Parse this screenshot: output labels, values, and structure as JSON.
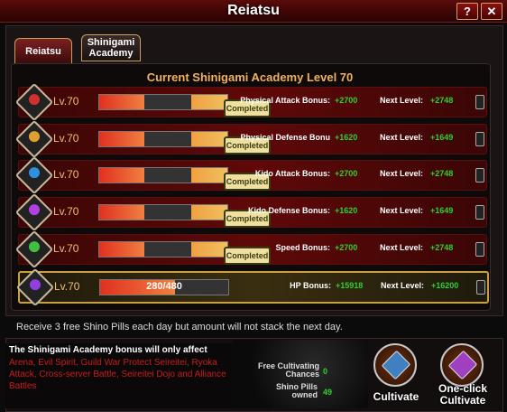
{
  "window": {
    "title": "Reiatsu",
    "help_label": "?",
    "close_label": "✕"
  },
  "tabs": [
    {
      "label": "Reiatsu"
    },
    {
      "label": "Shinigami Academy"
    }
  ],
  "heading": "Current Shinigami Academy Level 70",
  "rows": [
    {
      "level": "Lv.70",
      "status": "Completed",
      "bonus_label": "Physical Attack Bonus:",
      "bonus_value": "+2700",
      "next_label": "Next Level:",
      "next_value": "+2748",
      "icon": "fist-icon",
      "color": "#d03030"
    },
    {
      "level": "Lv.70",
      "status": "Completed",
      "bonus_label": "Physical Defense Bonu",
      "bonus_value": "+1620",
      "next_label": "Next Level:",
      "next_value": "+1649",
      "icon": "shield-icon",
      "color": "#e0a030"
    },
    {
      "level": "Lv.70",
      "status": "Completed",
      "bonus_label": "Kido Attack Bonus:",
      "bonus_value": "+2700",
      "next_label": "Next Level:",
      "next_value": "+2748",
      "icon": "spiral-icon",
      "color": "#3090e0"
    },
    {
      "level": "Lv.70",
      "status": "Completed",
      "bonus_label": "Kido Defense Bonus:",
      "bonus_value": "+1620",
      "next_label": "Next Level:",
      "next_value": "+1649",
      "icon": "half-moon-icon",
      "color": "#b040e0"
    },
    {
      "level": "Lv.70",
      "status": "Completed",
      "bonus_label": "Speed Bonus:",
      "bonus_value": "+2700",
      "next_label": "Next Level:",
      "next_value": "+2748",
      "icon": "wing-icon",
      "color": "#40c040"
    },
    {
      "level": "Lv.70",
      "progress_text": "280/480",
      "progress": 0.583,
      "bonus_label": "HP Bonus:",
      "bonus_value": "+15918",
      "next_label": "Next Level:",
      "next_value": "+16200",
      "icon": "heart-spiral-icon",
      "color": "#9040e0"
    }
  ],
  "note": "Receive 3 free Shino Pills each day but amount will not stack the next day.",
  "bonus_box": {
    "title": "The Shinigami Academy bonus will only affect",
    "list": "Arena, Evil Spirit, Guild War Protect Seireitei, Ryoka Attack, Cross-server Battle, Seireitei Dojo and Alliance Battles"
  },
  "stats": {
    "free_label_1": "Free Cultivating",
    "free_label_2": "Chances",
    "free_value": "0",
    "pills_label_1": "Shino Pills",
    "pills_label_2": "owned",
    "pills_value": "49"
  },
  "actions": {
    "cultivate_label": "Cultivate",
    "oneclick_label_1": "One-click",
    "oneclick_label_2": "Cultivate"
  }
}
